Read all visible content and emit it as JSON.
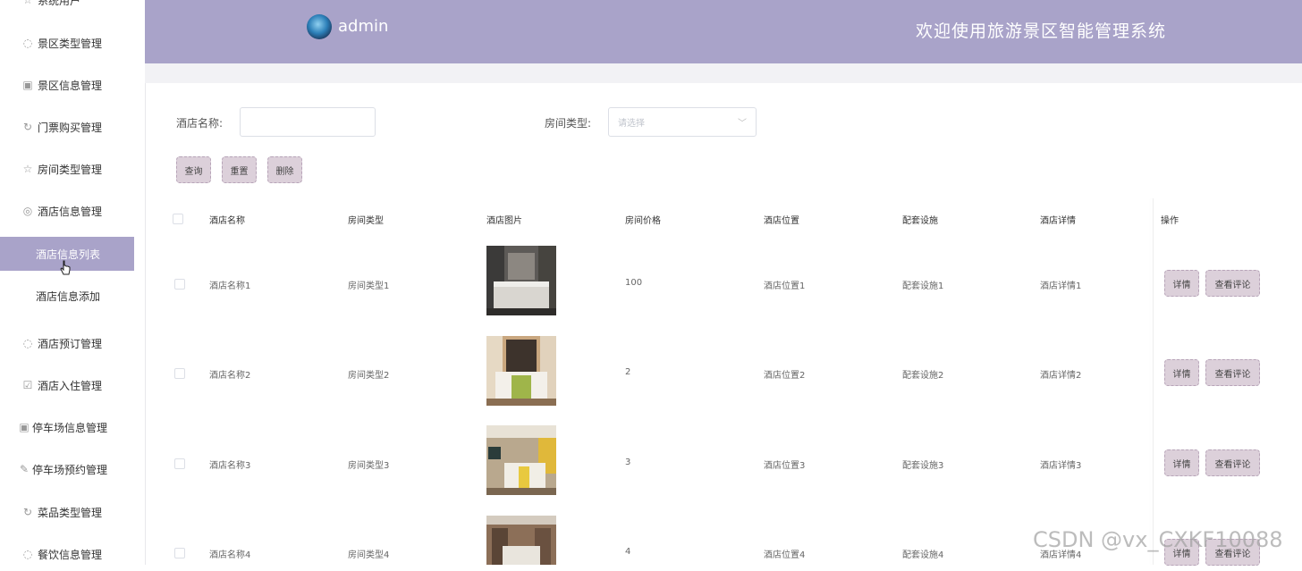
{
  "sidebar": {
    "items": [
      {
        "label": "系统用户",
        "icon": "star-icon"
      },
      {
        "label": "景区类型管理",
        "icon": "fire-icon"
      },
      {
        "label": "景区信息管理",
        "icon": "calendar-icon"
      },
      {
        "label": "门票购买管理",
        "icon": "refresh-icon"
      },
      {
        "label": "房间类型管理",
        "icon": "star-icon"
      },
      {
        "label": "酒店信息管理",
        "icon": "compass-icon"
      },
      {
        "label": "酒店信息列表",
        "icon": "",
        "active": true
      },
      {
        "label": "酒店信息添加",
        "icon": ""
      },
      {
        "label": "酒店预订管理",
        "icon": "fire-icon"
      },
      {
        "label": "酒店入住管理",
        "icon": "checkbox-icon"
      },
      {
        "label": "停车场信息管理",
        "icon": "calendar-icon"
      },
      {
        "label": "停车场预约管理",
        "icon": "edit-icon"
      },
      {
        "label": "菜品类型管理",
        "icon": "refresh-icon"
      },
      {
        "label": "餐饮信息管理",
        "icon": "fire-icon"
      }
    ]
  },
  "header": {
    "username": "admin",
    "title": "欢迎使用旅游景区智能管理系统"
  },
  "search": {
    "hotel_name_label": "酒店名称:",
    "hotel_name_value": "",
    "room_type_label": "房间类型:",
    "room_type_placeholder": "请选择",
    "query_label": "查询",
    "reset_label": "重置",
    "delete_label": "删除"
  },
  "table": {
    "headers": [
      "酒店名称",
      "房间类型",
      "酒店图片",
      "房间价格",
      "酒店位置",
      "配套设施",
      "酒店详情",
      "操作"
    ],
    "detail_label": "详情",
    "comment_label": "查看评论",
    "rows": [
      {
        "name": "酒店名称1",
        "room_type": "房间类型1",
        "price": "100",
        "location": "酒店位置1",
        "facility": "配套设施1",
        "detail": "酒店详情1"
      },
      {
        "name": "酒店名称2",
        "room_type": "房间类型2",
        "price": "2",
        "location": "酒店位置2",
        "facility": "配套设施2",
        "detail": "酒店详情2"
      },
      {
        "name": "酒店名称3",
        "room_type": "房间类型3",
        "price": "3",
        "location": "酒店位置3",
        "facility": "配套设施3",
        "detail": "酒店详情3"
      },
      {
        "name": "酒店名称4",
        "room_type": "房间类型4",
        "price": "4",
        "location": "酒店位置4",
        "facility": "配套设施4",
        "detail": "酒店详情4"
      }
    ]
  },
  "watermark": "CSDN @vx_CXKF10088",
  "colors": {
    "accent": "#a9a3c9",
    "button_bg": "#dcd0da"
  }
}
